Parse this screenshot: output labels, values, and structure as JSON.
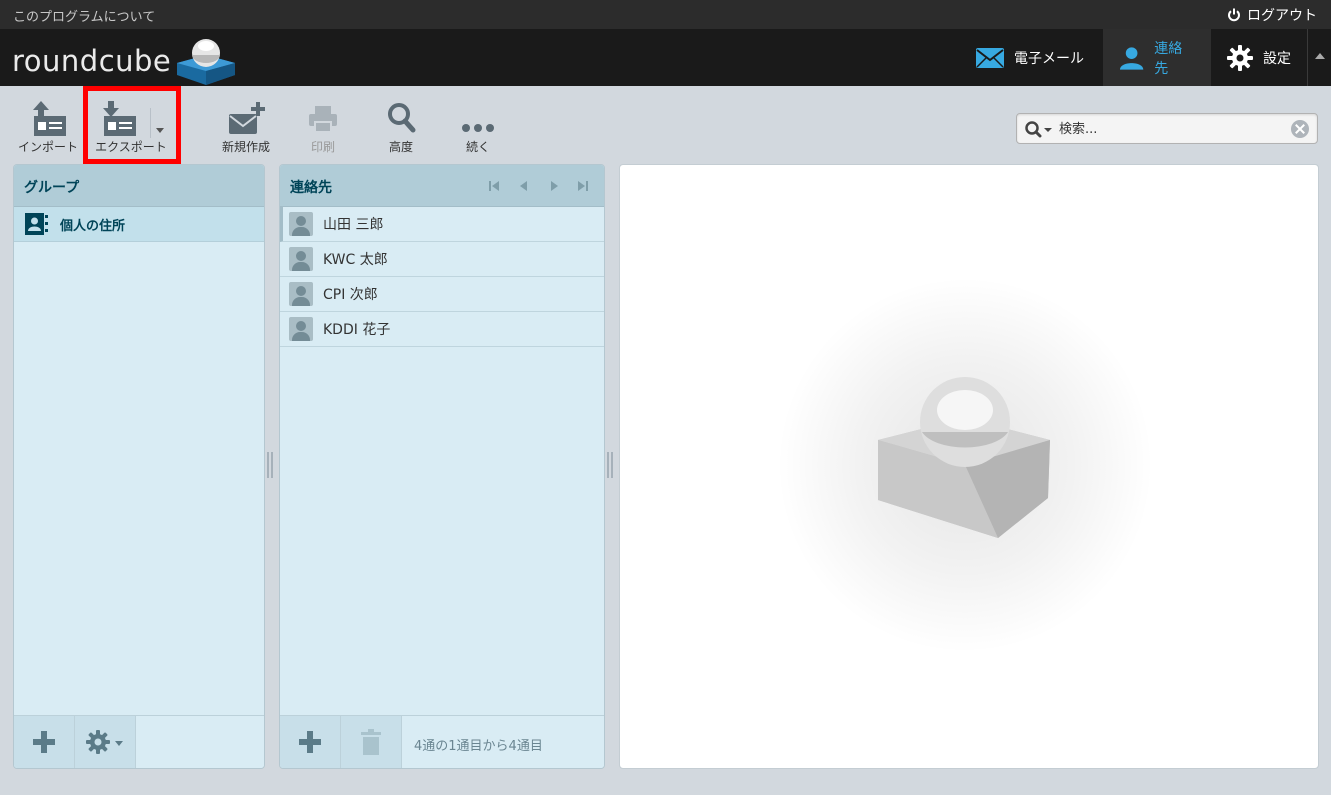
{
  "topline": {
    "about_label": "このプログラムについて",
    "logout_label": "ログアウト"
  },
  "header": {
    "logo_text": "roundcube",
    "tasks": {
      "mail": "電子メール",
      "contacts": "連絡先",
      "settings": "設定"
    }
  },
  "toolbar": {
    "import": "インポート",
    "export": "エクスポート",
    "compose": "新規作成",
    "print": "印刷",
    "advanced": "高度",
    "more": "続く"
  },
  "search": {
    "placeholder": "検索..."
  },
  "groups": {
    "title": "グループ",
    "items": [
      {
        "label": "個人の住所"
      }
    ]
  },
  "contacts": {
    "title": "連絡先",
    "items": [
      {
        "name": "山田 三郎"
      },
      {
        "name": "KWC 太郎"
      },
      {
        "name": "CPI 次郎"
      },
      {
        "name": "KDDI 花子"
      }
    ],
    "count_text": "4通の1通目から4通目"
  },
  "colors": {
    "accent": "#37a9e1",
    "highlight_border": "#ff0000",
    "panel_head": "#b0ccd7",
    "panel_bg": "#d9ecf4"
  }
}
